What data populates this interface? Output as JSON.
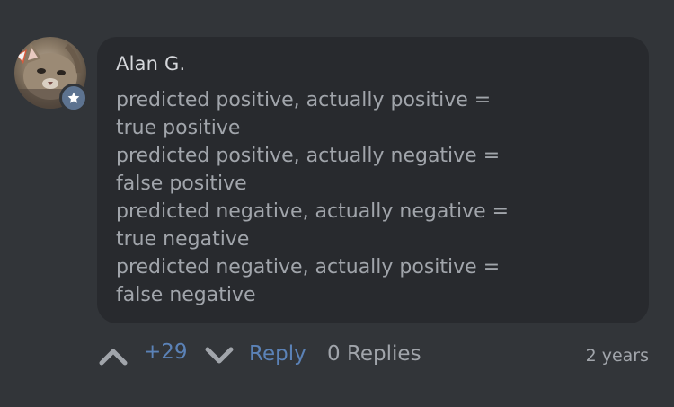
{
  "comment": {
    "author": "Alan G.",
    "lines": [
      "predicted positive, actually positive =",
      "true positive",
      "predicted positive, actually negative =",
      "false positive",
      "predicted negative, actually negative =",
      "true negative",
      "predicted negative, actually positive =",
      "false negative"
    ],
    "avatar_icon": "cat-photo-avatar",
    "badge_icon": "star-icon",
    "badge_color": "#5d7390"
  },
  "actions": {
    "upvote_icon": "chevron-up-icon",
    "score": "+29",
    "downvote_icon": "chevron-down-icon",
    "reply_label": "Reply",
    "replies_label": "0 Replies",
    "timestamp": "2 years"
  },
  "colors": {
    "background": "#323539",
    "bubble": "#282a2e",
    "accent": "#5b82b7",
    "text": "#a1a5ab"
  }
}
